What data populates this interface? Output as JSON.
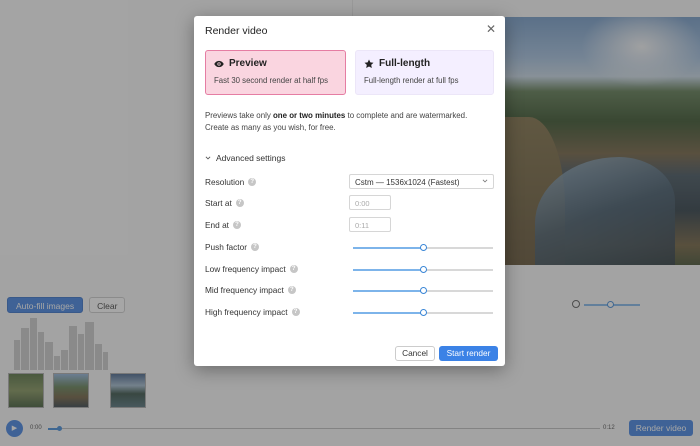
{
  "background": {
    "toolbar": {
      "autofill_label": "Auto-fill images",
      "clear_label": "Clear"
    },
    "timeline": {
      "time_start": "0:00",
      "time_end": "0:12",
      "render_label": "Render video",
      "position_fraction": 0.02
    },
    "zoom_level_fraction": 0.45
  },
  "modal": {
    "title": "Render video",
    "modes": [
      {
        "title": "Preview",
        "description": "Fast 30 second render at half fps",
        "icon": "eye-icon",
        "selected": true
      },
      {
        "title": "Full-length",
        "description": "Full-length render at full fps",
        "icon": "star-icon",
        "selected": false
      }
    ],
    "info_prefix": "Previews take only ",
    "info_bold": "one or two minutes",
    "info_suffix": " to complete and are watermarked.",
    "info_line2": "Create as many as you wish, for free.",
    "advanced_label": "Advanced settings",
    "settings": {
      "resolution": {
        "label": "Resolution",
        "value": "Cstm — 1536x1024 (Fastest)"
      },
      "start_at": {
        "label": "Start at",
        "placeholder": "0:00"
      },
      "end_at": {
        "label": "End at",
        "placeholder": "0:11"
      },
      "sliders": [
        {
          "label": "Push factor",
          "value": 0.5
        },
        {
          "label": "Low frequency impact",
          "value": 0.5
        },
        {
          "label": "Mid frequency impact",
          "value": 0.5
        },
        {
          "label": "High frequency impact",
          "value": 0.5
        }
      ]
    },
    "cancel_label": "Cancel",
    "start_label": "Start render"
  },
  "colors": {
    "accent": "#3b82e6",
    "preview_card_bg": "#fad5e0",
    "preview_card_border": "#e57da3",
    "full_card_bg": "#f4efff"
  }
}
